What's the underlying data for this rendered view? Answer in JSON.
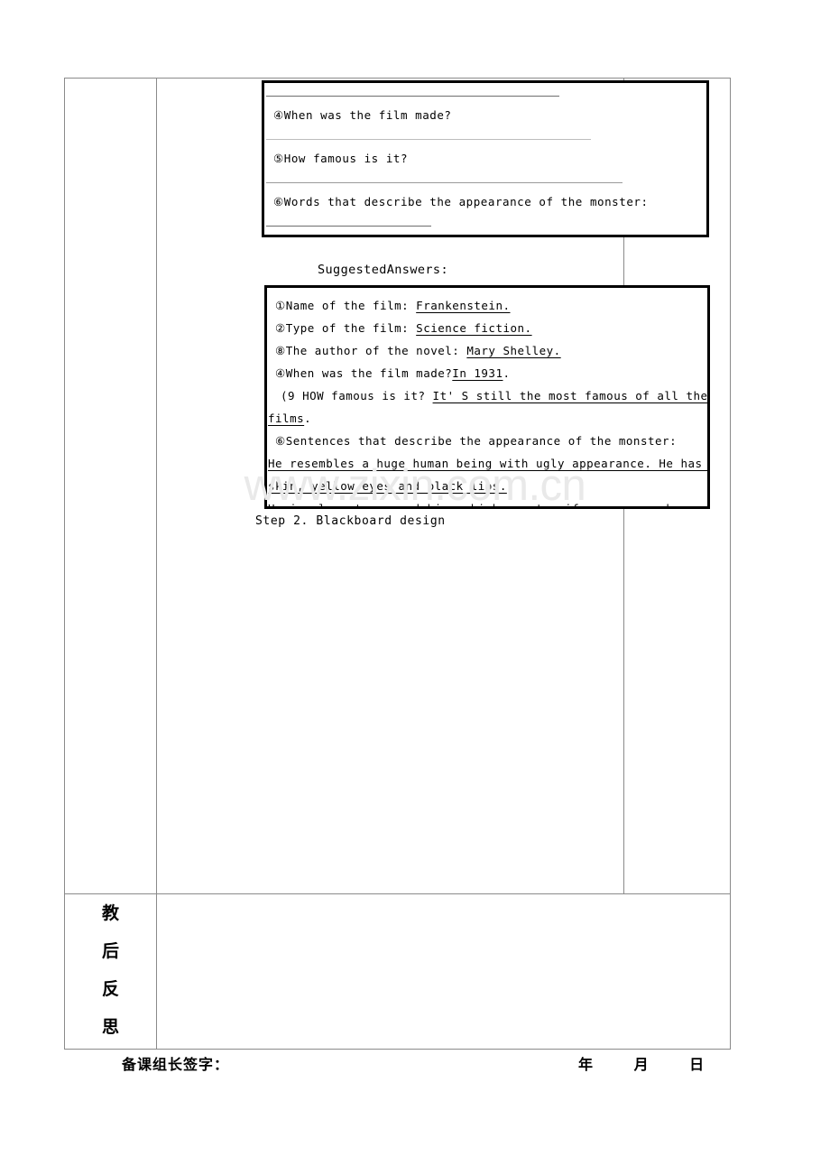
{
  "document": {
    "watermark": "www.zixin.com.cn"
  },
  "question_box": {
    "items": [
      {
        "marker": "④",
        "text": "When was the film made?"
      },
      {
        "marker": "⑤",
        "text": "How famous is it?"
      },
      {
        "marker": "⑥",
        "text": "Words that describe the appearance of the monster:"
      }
    ]
  },
  "suggested_answers": {
    "heading": "SuggestedAnswers:",
    "lines": [
      {
        "label": "①Name of the film: ",
        "answer": "Frankenstein. "
      },
      {
        "label": "②Type of the film: ",
        "answer": "Science fiction. "
      },
      {
        "label": "⑧The author of the novel: ",
        "answer": "Mary Shelley. "
      },
      {
        "label": "④When was the film made?",
        "answer": "In 1931",
        "tail": "."
      },
      {
        "label": "(9 HOW famous is it? ",
        "answer": "It' S still the most famous of all the horror"
      },
      {
        "label": "",
        "answer": "films",
        "tail": "."
      },
      {
        "label": "⑥Sentences that describe the appearance of the monster:",
        "answer": ""
      },
      {
        "label": "",
        "answer": " He resembles a huge human being with ugly appearance. He has wrinkl"
      },
      {
        "label": "",
        "answer": "skin, yellow eyes and black lips. "
      },
      {
        "label": "",
        "answer": "He is also strong and big, which can terrify everyone who sees him. "
      }
    ]
  },
  "step": {
    "text": "Step 2. Blackboard design"
  },
  "reflection": {
    "label_chars": [
      "教",
      "后",
      "反",
      "思"
    ]
  },
  "footer": {
    "signature_label": "备课组长签字：",
    "year": "年",
    "month": "月",
    "day": "日"
  }
}
